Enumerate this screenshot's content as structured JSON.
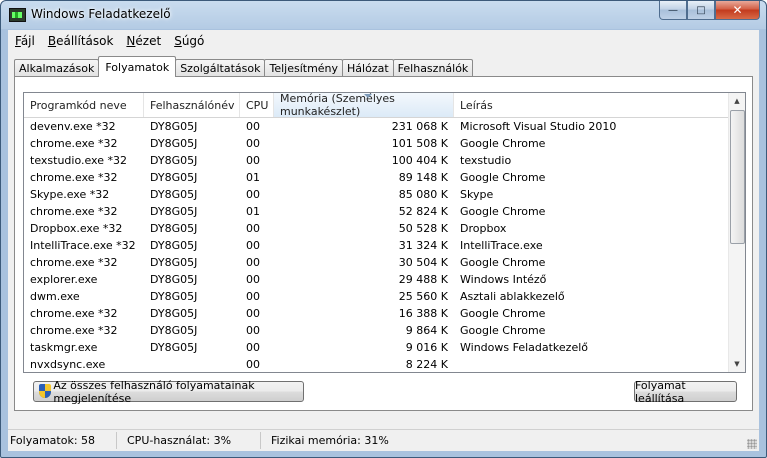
{
  "window": {
    "title": "Windows Feladatkezelő"
  },
  "menu": [
    {
      "u": "F",
      "rest": "ájl"
    },
    {
      "u": "B",
      "rest": "eállítások"
    },
    {
      "u": "N",
      "rest": "ézet"
    },
    {
      "u": "S",
      "rest": "úgó"
    }
  ],
  "tabs": [
    "Alkalmazások",
    "Folyamatok",
    "Szolgáltatások",
    "Teljesítmény",
    "Hálózat",
    "Felhasználók"
  ],
  "active_tab": "Folyamatok",
  "columns": [
    "Programkód neve",
    "Felhasználónév",
    "CPU",
    "Memória (Személyes munkakészlet)",
    "Leírás"
  ],
  "processes": [
    {
      "name": "devenv.exe *32",
      "user": "DY8G05J",
      "cpu": "00",
      "mem": "231 068 K",
      "desc": "Microsoft Visual Studio 2010"
    },
    {
      "name": "chrome.exe *32",
      "user": "DY8G05J",
      "cpu": "00",
      "mem": "101 508 K",
      "desc": "Google Chrome"
    },
    {
      "name": "texstudio.exe *32",
      "user": "DY8G05J",
      "cpu": "00",
      "mem": "100 404 K",
      "desc": "texstudio"
    },
    {
      "name": "chrome.exe *32",
      "user": "DY8G05J",
      "cpu": "01",
      "mem": "89 148 K",
      "desc": "Google Chrome"
    },
    {
      "name": "Skype.exe *32",
      "user": "DY8G05J",
      "cpu": "00",
      "mem": "85 080 K",
      "desc": "Skype"
    },
    {
      "name": "chrome.exe *32",
      "user": "DY8G05J",
      "cpu": "01",
      "mem": "52 824 K",
      "desc": "Google Chrome"
    },
    {
      "name": "Dropbox.exe *32",
      "user": "DY8G05J",
      "cpu": "00",
      "mem": "50 528 K",
      "desc": "Dropbox"
    },
    {
      "name": "IntelliTrace.exe *32",
      "user": "DY8G05J",
      "cpu": "00",
      "mem": "31 324 K",
      "desc": "IntelliTrace.exe"
    },
    {
      "name": "chrome.exe *32",
      "user": "DY8G05J",
      "cpu": "00",
      "mem": "30 504 K",
      "desc": "Google Chrome"
    },
    {
      "name": "explorer.exe",
      "user": "DY8G05J",
      "cpu": "00",
      "mem": "29 488 K",
      "desc": "Windows Intéző"
    },
    {
      "name": "dwm.exe",
      "user": "DY8G05J",
      "cpu": "00",
      "mem": "25 560 K",
      "desc": "Asztali ablakkezelő"
    },
    {
      "name": "chrome.exe *32",
      "user": "DY8G05J",
      "cpu": "00",
      "mem": "16 388 K",
      "desc": "Google Chrome"
    },
    {
      "name": "chrome.exe *32",
      "user": "DY8G05J",
      "cpu": "00",
      "mem": "9 864 K",
      "desc": "Google Chrome"
    },
    {
      "name": "taskmgr.exe",
      "user": "DY8G05J",
      "cpu": "00",
      "mem": "9 016 K",
      "desc": "Windows Feladatkezelő"
    },
    {
      "name": "nvxdsync.exe",
      "user": "",
      "cpu": "00",
      "mem": "8 224 K",
      "desc": ""
    }
  ],
  "buttons": {
    "show_all": "Az összes felhasználó folyamatainak megjelenítése",
    "end_process": "Folyamat leállítása"
  },
  "status": {
    "processes": "Folyamatok: 58",
    "cpu": "CPU-használat: 3%",
    "memory": "Fizikai memória: 31%"
  }
}
